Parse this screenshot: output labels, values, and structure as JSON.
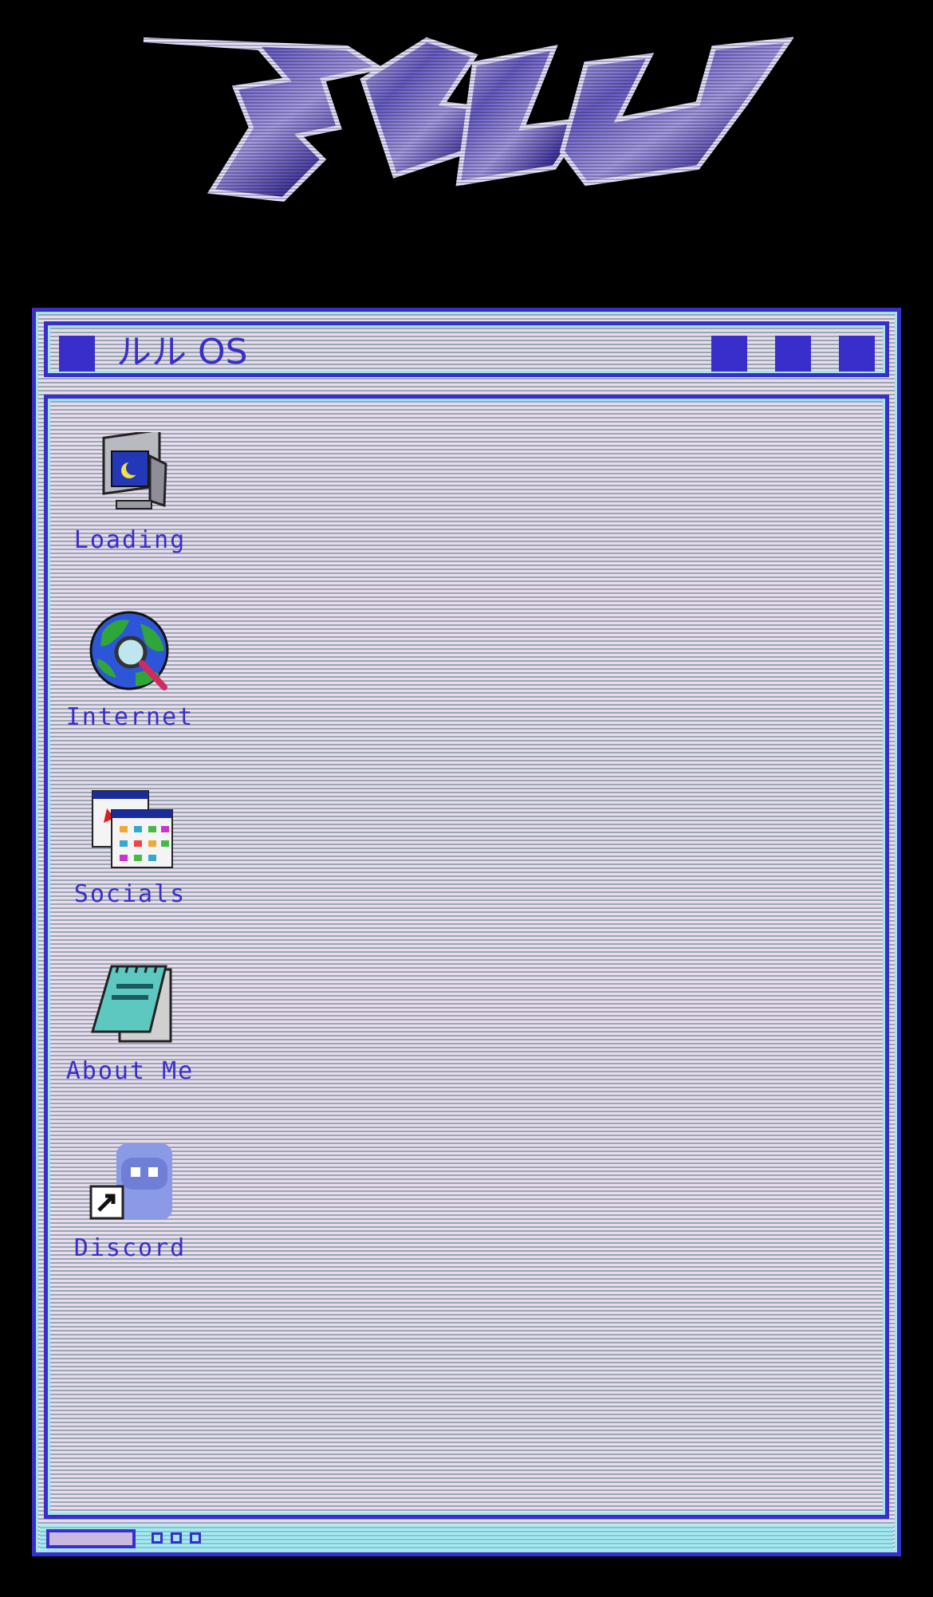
{
  "window": {
    "title": "ルル OS"
  },
  "desktop": {
    "icons": [
      {
        "label": "Loading",
        "icon": "monitor-icon"
      },
      {
        "label": "Internet",
        "icon": "globe-search-icon"
      },
      {
        "label": "Socials",
        "icon": "app-windows-icon"
      },
      {
        "label": "About Me",
        "icon": "notepad-icon"
      },
      {
        "label": "Discord",
        "icon": "discord-shortcut-icon"
      }
    ]
  },
  "colors": {
    "accent": "#3a2ecb",
    "highlight": "#9ee6ee",
    "window_bg": "#dcd0e6",
    "page_bg": "#000000"
  }
}
